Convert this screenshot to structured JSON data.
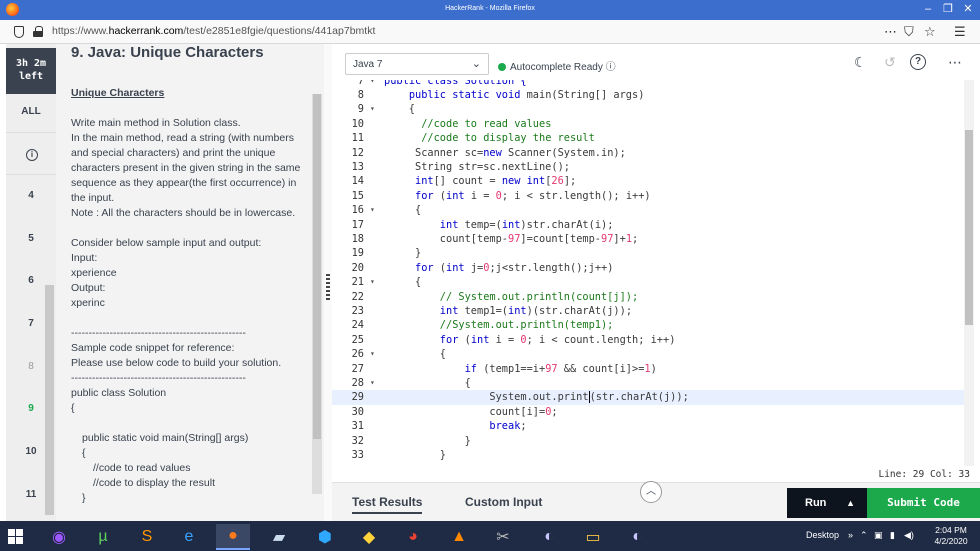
{
  "window": {
    "title": "HackerRank - Mozilla Firefox"
  },
  "browser": {
    "url_prefix": "https://www.",
    "url_domain": "hackerrank.com",
    "url_path": "/test/e2851e8fgie/questions/441ap7bmtkt"
  },
  "sidebar": {
    "timer_line1": "3h 2m",
    "timer_line2": "left",
    "all_label": "ALL",
    "items": [
      "4",
      "5",
      "6",
      "7",
      "8",
      "9",
      "10",
      "11"
    ]
  },
  "problem": {
    "title": "9. Java: Unique Characters",
    "heading": "Unique Characters",
    "paragraphs": [
      "Write main method in Solution class.",
      "In the main method,  read a string (with numbers and special characters) and print the unique characters present in the given string in the same sequence as they appear(the first occurrence) in the input.",
      "Note : All the characters should  be in lowercase."
    ],
    "sample_intro": "Consider below sample input and output:",
    "input_label": "Input:",
    "input_value": "xperience",
    "output_label": "Output:",
    "output_value": "xperinc",
    "dashes": "--------------------------------------------------",
    "snippet_line1": "Sample code snippet for reference:",
    "snippet_line2": "Please use below code to build your solution.",
    "code_class": "public class Solution",
    "code_brace": "{",
    "code_main": "public static void main(String[] args)",
    "code_brace2": "{",
    "code_comment1": "//code to read values",
    "code_comment2": "//code to display the result",
    "code_brace3": "}"
  },
  "editor": {
    "language": "Java 7",
    "autocomplete": "Autocomplete Ready",
    "status": "Line: 29 Col: 33",
    "partial_top_line": "public class Solution {",
    "lines": [
      {
        "n": "8",
        "fold": false,
        "html": "    <span class='kw'>public static void</span> main(String[] args)"
      },
      {
        "n": "9",
        "fold": true,
        "html": "    {"
      },
      {
        "n": "10",
        "fold": false,
        "html": "      <span class='cm'>//code to read values</span>"
      },
      {
        "n": "11",
        "fold": false,
        "html": "      <span class='cm'>//code to display the result</span>"
      },
      {
        "n": "12",
        "fold": false,
        "html": "     Scanner sc=<span class='kw'>new</span> Scanner(System.in);"
      },
      {
        "n": "13",
        "fold": false,
        "html": "     String str=sc.nextLine();"
      },
      {
        "n": "14",
        "fold": false,
        "html": "     <span class='kw'>int</span>[] count = <span class='kw'>new int</span>[<span class='num'>26</span>];"
      },
      {
        "n": "15",
        "fold": false,
        "html": "     <span class='kw'>for</span> (<span class='kw'>int</span> i = <span class='num'>0</span>; i &lt; str.length(); i++)"
      },
      {
        "n": "16",
        "fold": true,
        "html": "     {"
      },
      {
        "n": "17",
        "fold": false,
        "html": "         <span class='kw'>int</span> temp=(<span class='kw'>int</span>)str.charAt(i);"
      },
      {
        "n": "18",
        "fold": false,
        "html": "         count[temp-<span class='num'>97</span>]=count[temp-<span class='num'>97</span>]+<span class='num'>1</span>;"
      },
      {
        "n": "19",
        "fold": false,
        "html": "     }"
      },
      {
        "n": "20",
        "fold": false,
        "html": "     <span class='kw'>for</span> (<span class='kw'>int</span> j=<span class='num'>0</span>;j&lt;str.length();j++)"
      },
      {
        "n": "21",
        "fold": true,
        "html": "     {"
      },
      {
        "n": "22",
        "fold": false,
        "html": "         <span class='cm'>// System.out.println(count[j]);</span>"
      },
      {
        "n": "23",
        "fold": false,
        "html": "         <span class='kw'>int</span> temp1=(<span class='kw'>int</span>)(str.charAt(j));"
      },
      {
        "n": "24",
        "fold": false,
        "html": "         <span class='cm'>//System.out.println(temp1);</span>"
      },
      {
        "n": "25",
        "fold": false,
        "html": "         <span class='kw'>for</span> (<span class='kw'>int</span> i = <span class='num'>0</span>; i &lt; count.length; i++)"
      },
      {
        "n": "26",
        "fold": true,
        "html": "         {"
      },
      {
        "n": "27",
        "fold": false,
        "html": "             <span class='kw'>if</span> (temp1==i+<span class='num'>97</span> &amp;&amp; count[i]&gt;=<span class='num'>1</span>)"
      },
      {
        "n": "28",
        "fold": true,
        "html": "             {"
      },
      {
        "n": "29",
        "fold": false,
        "html": "                 System.out.print<span class='cursor'></span>(str.charAt(j));"
      },
      {
        "n": "30",
        "fold": false,
        "html": "                 count[i]=<span class='num'>0</span>;"
      },
      {
        "n": "31",
        "fold": false,
        "html": "                 <span class='kw'>break</span>;"
      },
      {
        "n": "32",
        "fold": false,
        "html": "             }"
      },
      {
        "n": "33",
        "fold": false,
        "html": "         }"
      }
    ]
  },
  "bottom": {
    "tab_results": "Test Results",
    "tab_custom": "Custom Input",
    "run": "Run",
    "submit": "Submit Code"
  },
  "taskbar": {
    "desktop": "Desktop",
    "time": "2:04 PM",
    "date": "4/2/2020"
  }
}
